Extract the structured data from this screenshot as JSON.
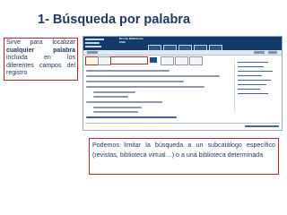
{
  "slide": {
    "title": "1- Búsqueda por palabra",
    "left_note": {
      "prefix": "Sirve para localizar ",
      "highlight": "cualquier palabra",
      "suffix": " incluida en los diferentes campos del registro"
    },
    "bottom_note": "Podemos limitar la búsqueda a un subcatálogo específico (revistas, biblioteca virtual…) o a una biblioteca determinada"
  },
  "screenshot": {
    "library_name_line1": "Red de Bibliotecas",
    "library_name_line2": "CSIC",
    "highlight_color": "#cc2222",
    "banner_color": "#123a6b"
  }
}
